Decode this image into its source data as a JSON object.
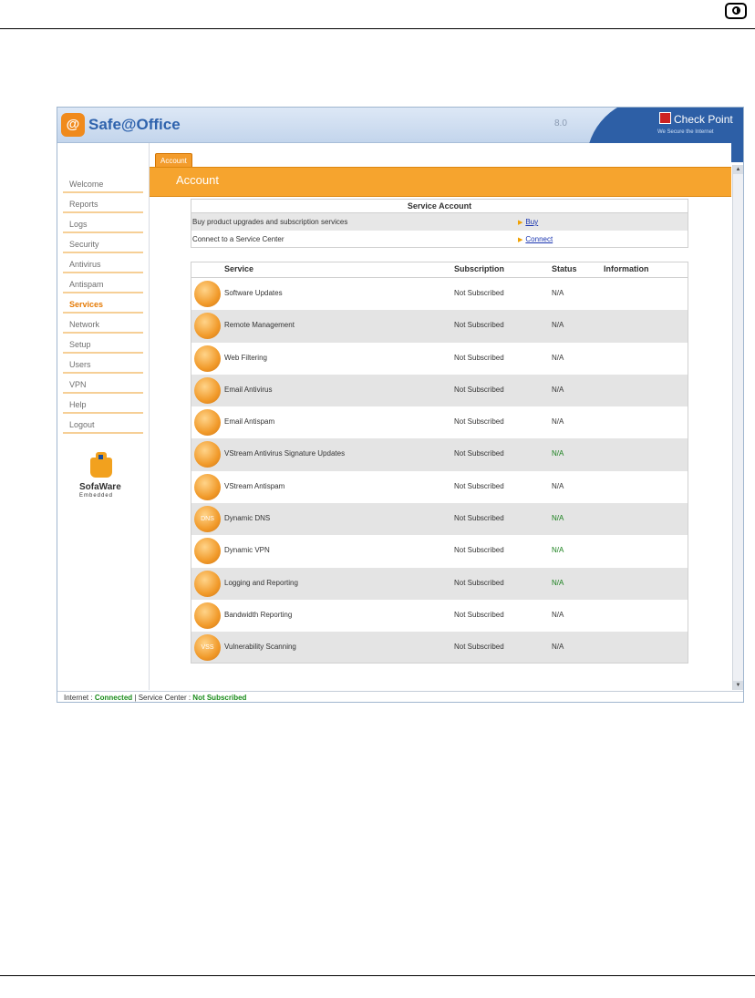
{
  "page": {
    "header_icon": "theme-toggle-icon"
  },
  "app": {
    "title": "Safe@Office",
    "logo_glyph": "@",
    "version": "8.0",
    "vendor": "Check Point",
    "vendor_tagline": "We Secure the Internet"
  },
  "sidebar": {
    "items": [
      {
        "label": "Welcome",
        "active": false
      },
      {
        "label": "Reports",
        "active": false
      },
      {
        "label": "Logs",
        "active": false
      },
      {
        "label": "Security",
        "active": false
      },
      {
        "label": "Antivirus",
        "active": false
      },
      {
        "label": "Antispam",
        "active": false
      },
      {
        "label": "Services",
        "active": true
      },
      {
        "label": "Network",
        "active": false
      },
      {
        "label": "Setup",
        "active": false
      },
      {
        "label": "Users",
        "active": false
      },
      {
        "label": "VPN",
        "active": false
      },
      {
        "label": "Help",
        "active": false
      },
      {
        "label": "Logout",
        "active": false
      }
    ],
    "brand": {
      "name": "SofaWare",
      "sub": "Embedded"
    }
  },
  "main": {
    "tab": "Account",
    "title": "Account",
    "account_table": {
      "header": "Service Account",
      "rows": [
        {
          "text": "Buy product upgrades and subscription services",
          "link": "Buy"
        },
        {
          "text": "Connect to a Service Center",
          "link": "Connect"
        }
      ]
    },
    "services_table": {
      "columns": [
        "Service",
        "Subscription",
        "Status",
        "Information"
      ],
      "rows": [
        {
          "icon": "software-updates-icon",
          "glyph": "",
          "service": "Software Updates",
          "subscription": "Not Subscribed",
          "status": "N/A",
          "status_color": "#333333"
        },
        {
          "icon": "remote-management-icon",
          "glyph": "",
          "service": "Remote Management",
          "subscription": "Not Subscribed",
          "status": "N/A",
          "status_color": "#333333"
        },
        {
          "icon": "web-filtering-icon",
          "glyph": "",
          "service": "Web Filtering",
          "subscription": "Not Subscribed",
          "status": "N/A",
          "status_color": "#333333"
        },
        {
          "icon": "email-antivirus-icon",
          "glyph": "",
          "service": "Email Antivirus",
          "subscription": "Not Subscribed",
          "status": "N/A",
          "status_color": "#333333"
        },
        {
          "icon": "email-antispam-icon",
          "glyph": "",
          "service": "Email Antispam",
          "subscription": "Not Subscribed",
          "status": "N/A",
          "status_color": "#333333"
        },
        {
          "icon": "vstream-antivirus-icon",
          "glyph": "",
          "service": "VStream Antivirus Signature Updates",
          "subscription": "Not Subscribed",
          "status": "N/A",
          "status_color": "#19801c"
        },
        {
          "icon": "vstream-antispam-icon",
          "glyph": "",
          "service": "VStream Antispam",
          "subscription": "Not Subscribed",
          "status": "N/A",
          "status_color": "#333333"
        },
        {
          "icon": "dynamic-dns-icon",
          "glyph": "DNS",
          "service": "Dynamic DNS",
          "subscription": "Not Subscribed",
          "status": "N/A",
          "status_color": "#19801c"
        },
        {
          "icon": "dynamic-vpn-icon",
          "glyph": "",
          "service": "Dynamic VPN",
          "subscription": "Not Subscribed",
          "status": "N/A",
          "status_color": "#19801c"
        },
        {
          "icon": "logging-reporting-icon",
          "glyph": "",
          "service": "Logging and Reporting",
          "subscription": "Not Subscribed",
          "status": "N/A",
          "status_color": "#19801c"
        },
        {
          "icon": "bandwidth-reporting-icon",
          "glyph": "",
          "service": "Bandwidth Reporting",
          "subscription": "Not Subscribed",
          "status": "N/A",
          "status_color": "#333333"
        },
        {
          "icon": "vulnerability-scanning-icon",
          "glyph": "VSS",
          "service": "Vulnerability Scanning",
          "subscription": "Not Subscribed",
          "status": "N/A",
          "status_color": "#333333"
        }
      ]
    }
  },
  "status_bar": {
    "internet_label": "Internet :",
    "internet_value": "Connected",
    "separator": "|",
    "center_label": "Service Center :",
    "center_value": "Not Subscribed"
  },
  "colors": {
    "accent": "#f6a42e",
    "link": "#1a35b0",
    "ok": "#1c8d1c"
  }
}
